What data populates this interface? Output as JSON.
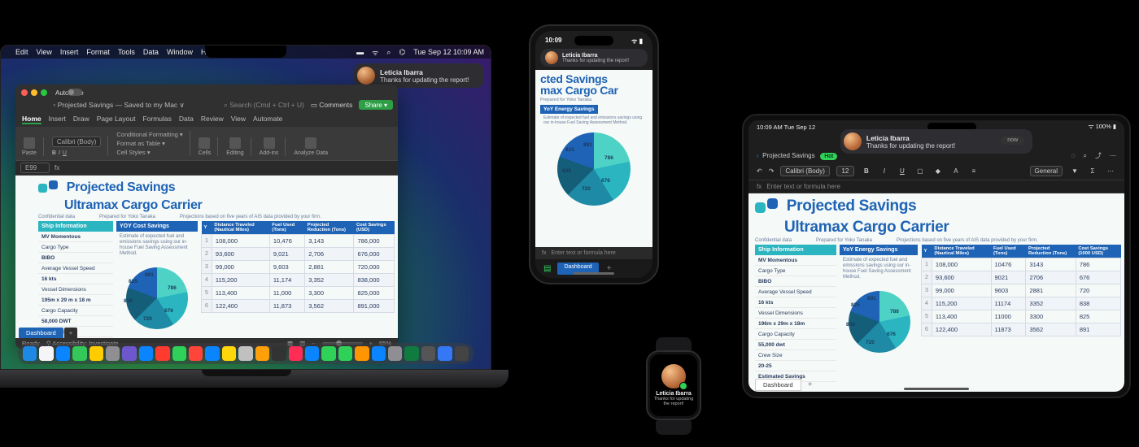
{
  "datetime": {
    "mac": "Tue Sep 12  10:09 AM",
    "iphone": "10:09",
    "ipad_left": "10:09 AM  Tue Sep 12",
    "ipad_right": "100%"
  },
  "menubar": {
    "items": [
      "Edit",
      "View",
      "Insert",
      "Format",
      "Tools",
      "Data",
      "Window",
      "Help"
    ]
  },
  "notification": {
    "name": "Leticia Ibarra",
    "message": "Thanks for updating the report!"
  },
  "excel": {
    "autosave": "AutoSave",
    "filename": "Projected Savings",
    "saved_to": "— Saved to my Mac ∨",
    "search_placeholder": "Search (Cmd + Ctrl + U)",
    "comments": "Comments",
    "share": "Share",
    "tabs": [
      "Home",
      "Insert",
      "Draw",
      "Page Layout",
      "Formulas",
      "Data",
      "Review",
      "View",
      "Automate"
    ],
    "font": "Calibri (Body)",
    "font_size": "12",
    "ribbon_groups": [
      "Paste",
      "Conditional Formatting ▾",
      "Format as Table ▾",
      "Cell Styles ▾",
      "Cells",
      "Editing",
      "Add-ins",
      "Analyze Data"
    ],
    "cell_ref": "E99",
    "sheet_tab": "Dashboard",
    "status_left": "Ready",
    "status_acc": "Accessibility: Investigate",
    "zoom": "65%"
  },
  "doc": {
    "title1": "Projected Savings",
    "title2": "Ultramax Cargo Carrier",
    "conf": "Confidential data",
    "prepared": "Prepared for Yoko Tanaka",
    "proj_note": "Projections based on five years of AIS data provided by your firm.",
    "ship_hdr": "Ship Information",
    "yoy_hdr_mac": "YOY Cost Savings",
    "yoy_hdr_ipad": "YoY Energy Savings",
    "yoy_note": "Estimate of expected fuel and emissions savings using our in-house Fuel Saving Assessment Method.",
    "ship_info": [
      {
        "k": "MV Momentous",
        "v": ""
      },
      {
        "k": "Cargo Type",
        "v": ""
      },
      {
        "k": "BIBO",
        "v": ""
      },
      {
        "k": "Average Vessel Speed",
        "v": ""
      },
      {
        "k": "16 kts",
        "v": ""
      },
      {
        "k": "Vessel Dimensions",
        "v": ""
      },
      {
        "k": "195m x 29 m x 18 m",
        "v": ""
      },
      {
        "k": "Cargo Capacity",
        "v": ""
      },
      {
        "k": "58,000 DWT",
        "v": ""
      },
      {
        "k": "Crew Size",
        "v": ""
      },
      {
        "k": "20-25",
        "v": ""
      }
    ],
    "ship_info_ipad_extra": "Estimated Savings",
    "ipad_dims": "196m x 29m x 18m",
    "ipad_capacity": "55,000 dwt",
    "cols": [
      "Y",
      "Distance Traveled (Nautical Miles)",
      "Fuel Used (Tons)",
      "Projected Reduction (Tons)",
      "Cost Savings (USD)"
    ],
    "cols_ipad": [
      "Y",
      "Distance Traveled (Nautical Miles)",
      "Fuel Used (Tons)",
      "Projected Reduction (Tons)",
      "Cost Savings (1000 USD)"
    ],
    "rows_mac": [
      [
        "1",
        "108,000",
        "10,476",
        "3,143",
        "786,000"
      ],
      [
        "2",
        "93,600",
        "9,021",
        "2,706",
        "676,000"
      ],
      [
        "3",
        "99,000",
        "9,603",
        "2,881",
        "720,000"
      ],
      [
        "4",
        "115,200",
        "11,174",
        "3,352",
        "838,000"
      ],
      [
        "5",
        "113,400",
        "11,000",
        "3,300",
        "825,000"
      ],
      [
        "6",
        "122,400",
        "11,873",
        "3,562",
        "891,000"
      ]
    ],
    "rows_ipad": [
      [
        "1",
        "108,000",
        "10476",
        "3143",
        "786"
      ],
      [
        "2",
        "93,600",
        "9021",
        "2706",
        "676"
      ],
      [
        "3",
        "99,000",
        "9603",
        "2881",
        "720"
      ],
      [
        "4",
        "115,200",
        "11174",
        "3352",
        "838"
      ],
      [
        "5",
        "113,400",
        "11000",
        "3300",
        "825"
      ],
      [
        "6",
        "122,400",
        "11873",
        "3562",
        "891"
      ]
    ]
  },
  "chart_data": {
    "type": "pie",
    "title": "YoY Energy Savings",
    "labels": [
      "891",
      "786",
      "676",
      "720",
      "838",
      "825"
    ],
    "values": [
      891,
      786,
      676,
      720,
      838,
      825
    ],
    "colors": [
      "#4fd2c6",
      "#2ab5c0",
      "#1e8aa5",
      "#155e7a",
      "#1e63b5",
      "#4da0d8"
    ]
  },
  "iphone": {
    "fx_placeholder": "Enter text or formula here",
    "prep_label": "Prepared for Yoko Tanaka"
  },
  "ipad": {
    "back": "Projected Savings",
    "hot": "Hot",
    "general": "General",
    "fx_placeholder": "Enter text or formula here",
    "chip": "now"
  },
  "dock_colors": [
    "#1e88e5",
    "#f5f5f7",
    "#0a84ff",
    "#34c759",
    "#ffcc00",
    "#8e8e93",
    "#6e56cf",
    "#0a84ff",
    "#ff3b30",
    "#30d158",
    "#ff453a",
    "#0a84ff",
    "#ffd60a",
    "#c0c0c0",
    "#ff9f0a",
    "#333",
    "#ff2d55",
    "#0a84ff",
    "#30d158",
    "#30d158",
    "#ff9500",
    "#0a84ff",
    "#8e8e93",
    "#0f7b3e",
    "#555",
    "#3478f6",
    "#444"
  ]
}
